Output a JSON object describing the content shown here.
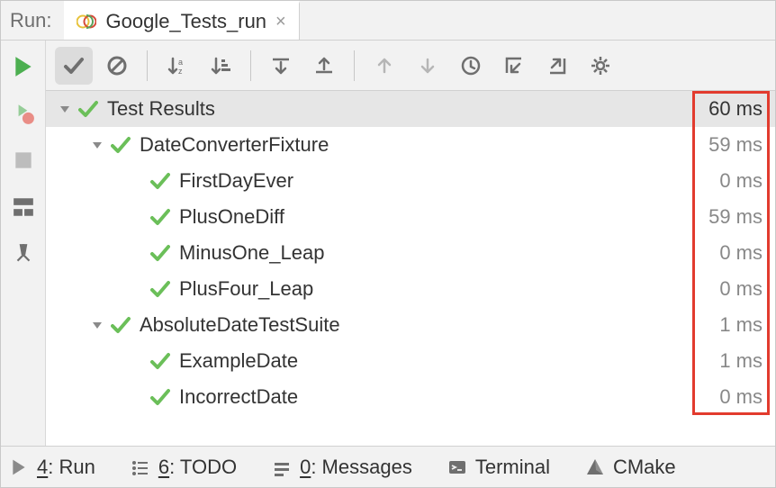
{
  "titlebar": {
    "run_label": "Run:"
  },
  "tab": {
    "title": "Google_Tests_run"
  },
  "tree": {
    "root": {
      "name": "Test Results",
      "time": "60 ms"
    },
    "suites": [
      {
        "name": "DateConverterFixture",
        "time": "59 ms",
        "tests": [
          {
            "name": "FirstDayEver",
            "time": "0 ms"
          },
          {
            "name": "PlusOneDiff",
            "time": "59 ms"
          },
          {
            "name": "MinusOne_Leap",
            "time": "0 ms"
          },
          {
            "name": "PlusFour_Leap",
            "time": "0 ms"
          }
        ]
      },
      {
        "name": "AbsoluteDateTestSuite",
        "time": "1 ms",
        "tests": [
          {
            "name": "ExampleDate",
            "time": "1 ms"
          },
          {
            "name": "IncorrectDate",
            "time": "0 ms"
          }
        ]
      }
    ]
  },
  "bottombar": {
    "run": {
      "accel": "4",
      "label": ": Run"
    },
    "todo": {
      "accel": "6",
      "label": ": TODO"
    },
    "messages": {
      "accel": "0",
      "label": ": Messages"
    },
    "terminal": {
      "label": "Terminal"
    },
    "cmake": {
      "label": "CMake"
    }
  }
}
